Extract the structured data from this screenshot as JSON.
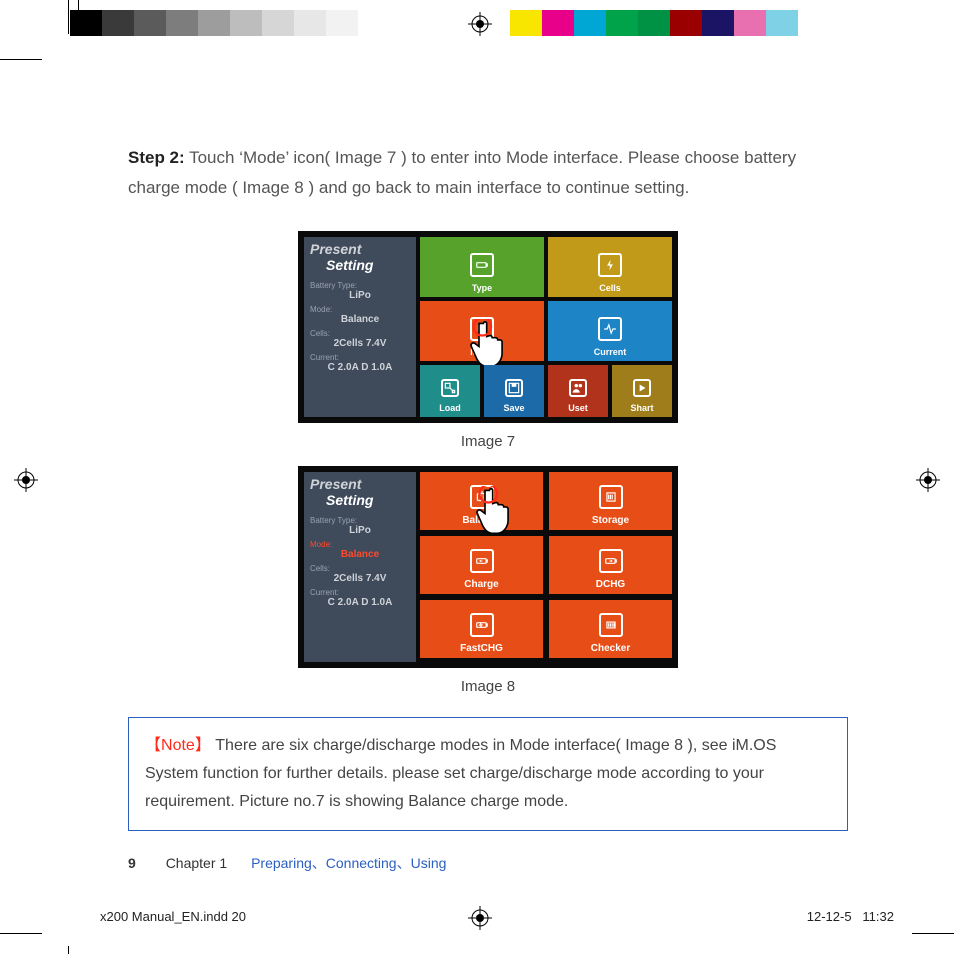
{
  "step": {
    "label": "Step 2:",
    "text": " Touch ‘Mode’ icon( Image 7 ) to enter into  Mode  interface. Please choose battery charge mode ( Image 8 ) and go back to main interface to continue setting."
  },
  "captions": {
    "img7": "Image 7",
    "img8": "Image 8"
  },
  "present": {
    "hdr1": "Present",
    "hdr2": "Setting",
    "battery_type_lbl": "Battery Type:",
    "battery_type_val": "LiPo",
    "mode_lbl": "Mode:",
    "mode_val": "Balance",
    "cells_lbl": "Cells:",
    "cells_val": "2Cells  7.4V",
    "current_lbl": "Current:",
    "current_val": "C 2.0A  D 1.0A"
  },
  "tiles7": {
    "type": {
      "label": "Type",
      "color": "#56a22b"
    },
    "cells": {
      "label": "Cells",
      "color": "#c29a1a"
    },
    "mode": {
      "label": "Mode",
      "color": "#e74e17"
    },
    "current": {
      "label": "Current",
      "color": "#1d84c6"
    },
    "load": {
      "label": "Load",
      "color": "#1f8e8a"
    },
    "save": {
      "label": "Save",
      "color": "#1d6aa8"
    },
    "uset": {
      "label": "Uset",
      "color": "#b2331b"
    },
    "shart": {
      "label": "Shart",
      "color": "#9f7d1a"
    }
  },
  "tiles8": {
    "balance": {
      "label": "Balance"
    },
    "storage": {
      "label": "Storage"
    },
    "charge": {
      "label": "Charge"
    },
    "dchg": {
      "label": "DCHG"
    },
    "fastchg": {
      "label": "FastCHG"
    },
    "checker": {
      "label": "Checker"
    }
  },
  "note": {
    "open": "【",
    "close": "】",
    "label": "Note",
    "text": " There are six charge/discharge modes in Mode interface( Image 8 ), see iM.OS System function for further details. please set charge/discharge mode according to your requirement. Picture no.7 is showing Balance charge mode."
  },
  "footer": {
    "page": "9",
    "chapter": "Chapter 1",
    "trail": "Preparing、Connecting、Using"
  },
  "indd": {
    "file": "x200 Manual_EN.indd   20",
    "date": "12-12-5",
    "time": "11:32"
  },
  "colors_left": [
    "#000000",
    "#3a3a3a",
    "#5b5b5b",
    "#7d7d7d",
    "#9d9d9d",
    "#bdbdbd",
    "#d6d6d6",
    "#e7e7e7",
    "#f2f2f2",
    "#ffffff"
  ],
  "colors_right": [
    "#f8e600",
    "#e8008a",
    "#00a7d4",
    "#00a24a",
    "#009244",
    "#9a0000",
    "#1b1464",
    "#e86fb0",
    "#7fd1e6",
    "#ffffff"
  ]
}
